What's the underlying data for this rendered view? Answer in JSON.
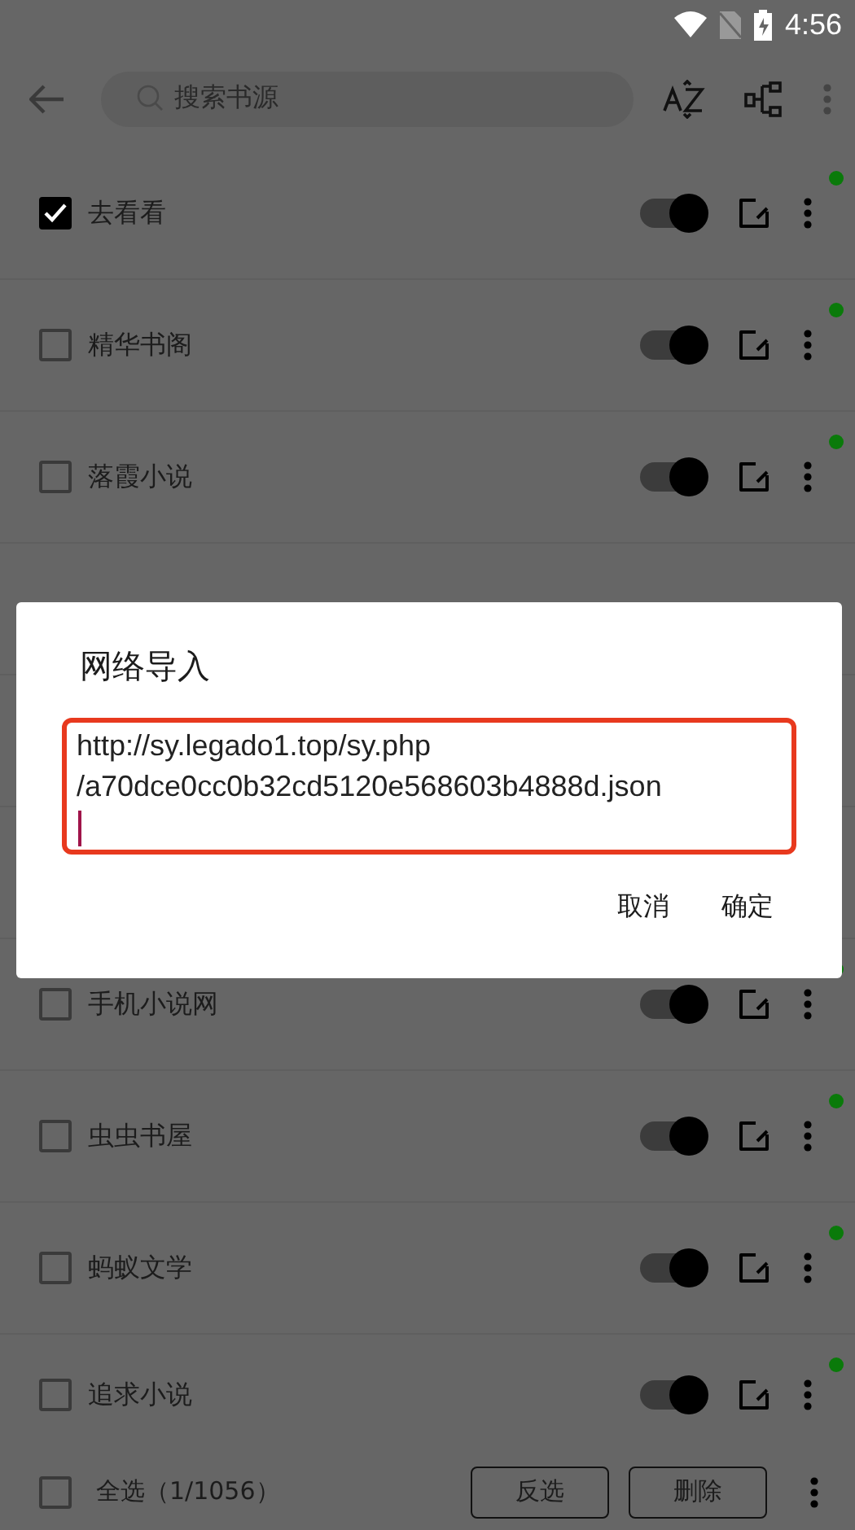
{
  "status_bar": {
    "time": "4:56"
  },
  "toolbar": {
    "search": {
      "placeholder": "搜索书源"
    }
  },
  "sources": [
    {
      "name": "去看看",
      "checked": true,
      "enabled": true
    },
    {
      "name": "精华书阁",
      "checked": false,
      "enabled": true
    },
    {
      "name": "落霞小说",
      "checked": false,
      "enabled": true
    },
    {
      "kind": "hidden"
    },
    {
      "kind": "hidden"
    },
    {
      "kind": "hidden"
    },
    {
      "name": "手机小说网",
      "checked": false,
      "enabled": true
    },
    {
      "name": "虫虫书屋",
      "checked": false,
      "enabled": true
    },
    {
      "name": "蚂蚁文学",
      "checked": false,
      "enabled": true
    },
    {
      "name": "追求小说",
      "checked": false,
      "enabled": true
    }
  ],
  "bottom_bar": {
    "select_all": {
      "label": "全选（1/1056）",
      "checked": false
    },
    "buttons": [
      "反选",
      "删除"
    ]
  },
  "dialog": {
    "title": "网络导入",
    "field": {
      "value": "http://sy.legado1.top/sy.php\n/a70dce0cc0b32cd5120e568603b4888d.json"
    },
    "buttons": [
      "取消",
      "确定"
    ]
  }
}
